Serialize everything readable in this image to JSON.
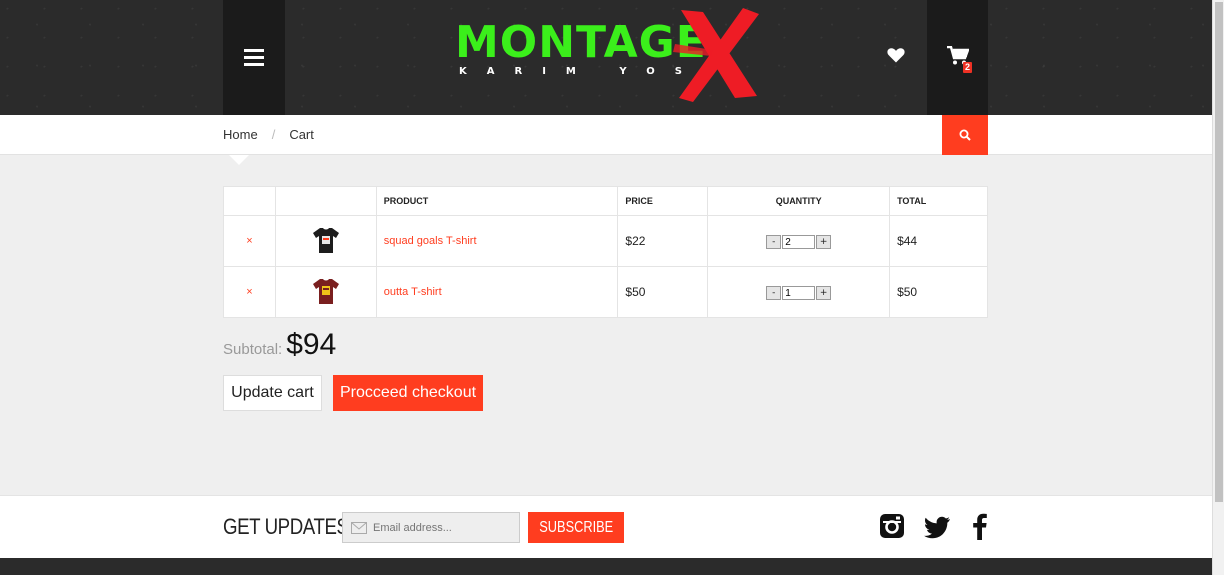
{
  "header": {
    "logo_word": "MONTAGE",
    "logo_sub": "KARIM YOSRY",
    "cart_count": "2",
    "colors": {
      "logo_green": "#3bef1b",
      "accent": "#ff3d1f",
      "header_bg": "#2b2b2b"
    }
  },
  "breadcrumb": {
    "home": "Home",
    "separator": "/",
    "current": "Cart"
  },
  "table": {
    "headers": {
      "product": "PRODUCT",
      "price": "PRICE",
      "quantity": "QUANTITY",
      "total": "TOTAL"
    },
    "rows": [
      {
        "remove": "×",
        "name": "squad goals T-shirt",
        "price": "$22",
        "qty": "2",
        "total": "$44",
        "shirt_color": "#1d1d1d"
      },
      {
        "remove": "×",
        "name": "outta T-shirt",
        "price": "$50",
        "qty": "1",
        "total": "$50",
        "shirt_color": "#7a1f1f"
      }
    ],
    "minus": "-",
    "plus": "+"
  },
  "summary": {
    "subtotal_label": "Subtotal:",
    "subtotal_value": "$94",
    "update_label": "Update cart",
    "checkout_label": "Procceed checkout"
  },
  "footer": {
    "updates_title": "GET UPDATES",
    "email_placeholder": "Email address...",
    "subscribe_label": "SUBSCRIBE",
    "social": [
      "instagram-icon",
      "twitter-icon",
      "facebook-icon"
    ]
  }
}
